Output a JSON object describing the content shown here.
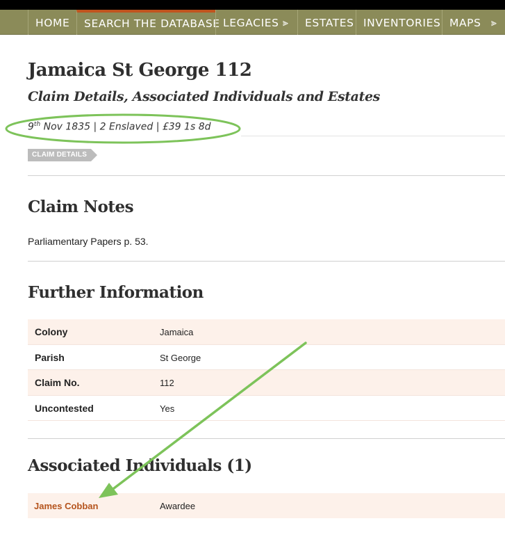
{
  "nav": {
    "items": [
      {
        "label": "HOME"
      },
      {
        "label": "SEARCH THE DATABASE"
      },
      {
        "label": "LEGACIES"
      },
      {
        "label": "ESTATES"
      },
      {
        "label": "INVENTORIES"
      },
      {
        "label": "MAPS"
      }
    ],
    "accent_color": "#c0541e",
    "bar_color": "#8b8b59"
  },
  "page": {
    "title": "Jamaica St George 112",
    "subtitle": "Claim Details, Associated Individuals and Estates",
    "summary": {
      "day": "9",
      "day_suffix": "th",
      "rest": " Nov 1835 | 2 Enslaved | £39 1s 8d"
    },
    "tag": "CLAIM DETAILS"
  },
  "claim_notes": {
    "title": "Claim Notes",
    "text": "Parliamentary Papers p. 53."
  },
  "further_info": {
    "title": "Further Information",
    "rows": [
      {
        "key": "Colony",
        "value": "Jamaica"
      },
      {
        "key": "Parish",
        "value": "St George"
      },
      {
        "key": "Claim No.",
        "value": "112"
      },
      {
        "key": "Uncontested",
        "value": "Yes"
      }
    ]
  },
  "associated": {
    "title": "Associated Individuals (1)",
    "rows": [
      {
        "name": "James Cobban",
        "role": "Awardee"
      }
    ],
    "link_color": "#b5541d"
  },
  "annotations": {
    "color": "#7dc35a",
    "icons": [
      "highlight-ellipse",
      "arrow-pointer"
    ]
  }
}
